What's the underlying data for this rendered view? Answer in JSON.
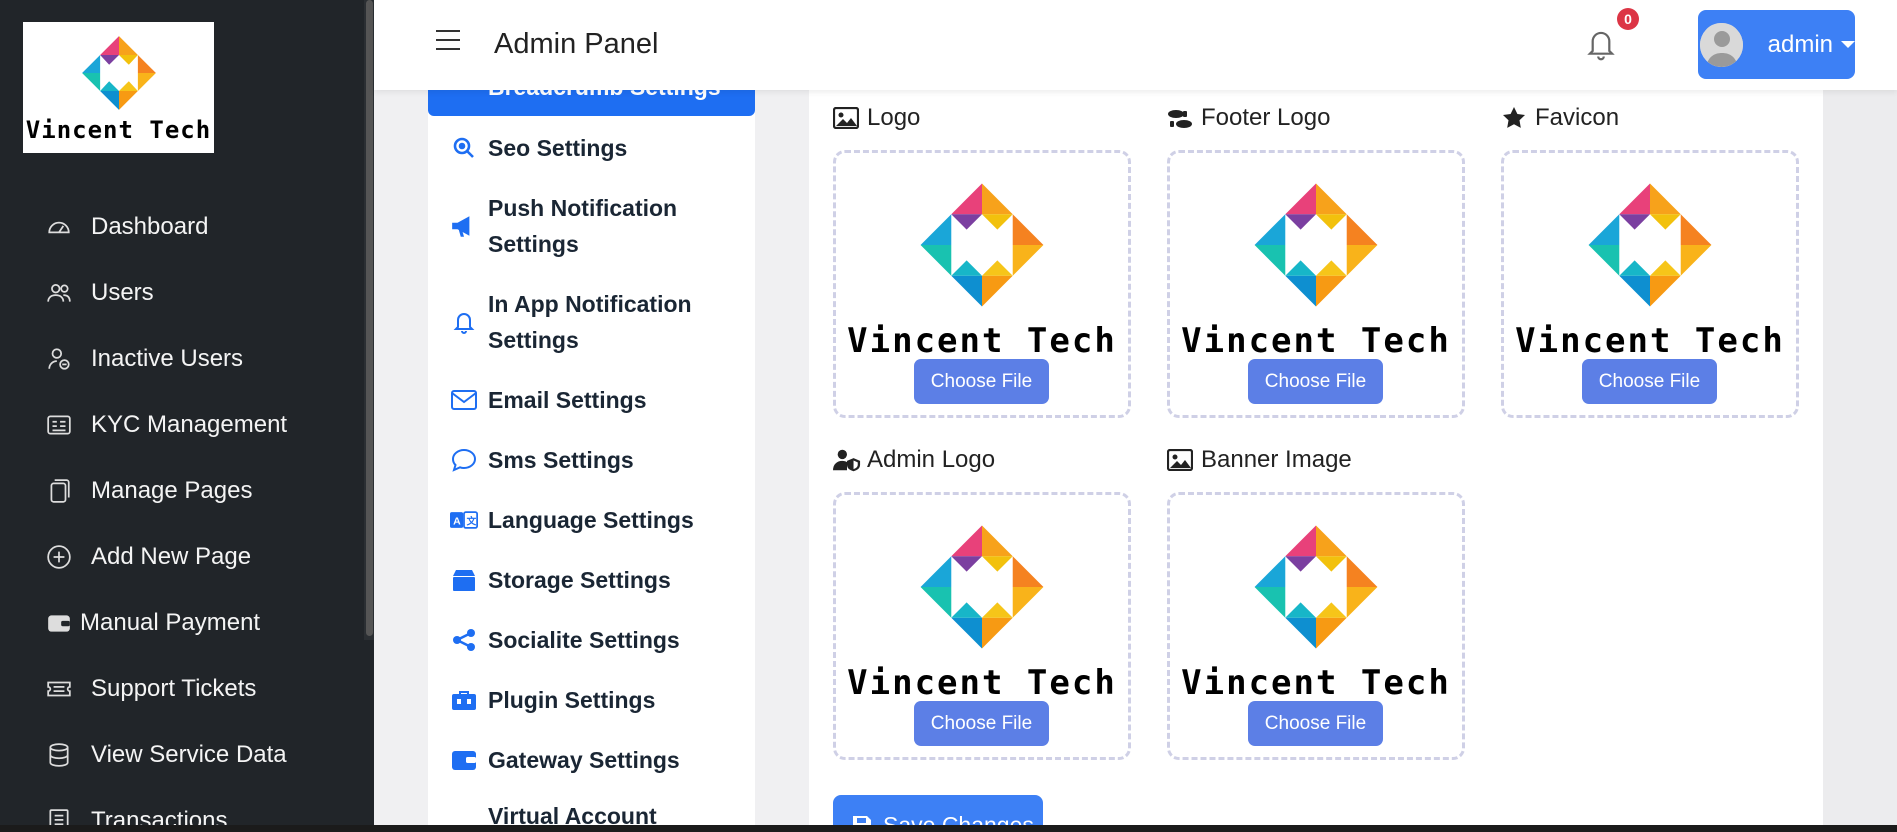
{
  "brand": {
    "name": "Vincent Tech"
  },
  "sidebar": {
    "items": [
      {
        "label": "Dashboard",
        "icon": "dashboard-gauge-icon"
      },
      {
        "label": "Users",
        "icon": "users-icon"
      },
      {
        "label": "Inactive Users",
        "icon": "inactive-user-icon"
      },
      {
        "label": "KYC Management",
        "icon": "id-card-icon"
      },
      {
        "label": "Manage Pages",
        "icon": "pages-icon"
      },
      {
        "label": "Add New Page",
        "icon": "plus-circle-icon"
      },
      {
        "label": "Manual Payment",
        "icon": "wallet-icon"
      },
      {
        "label": "Support Tickets",
        "icon": "ticket-icon"
      },
      {
        "label": "View Service Data",
        "icon": "database-icon"
      },
      {
        "label": "Transactions",
        "icon": "receipt-icon"
      }
    ]
  },
  "topbar": {
    "title": "Admin Panel",
    "notification_count": "0",
    "user_name": "admin"
  },
  "settings_menu": {
    "active_item": "Breadcrumb Settings",
    "items": [
      {
        "label": "Seo Settings",
        "icon": "search-icon"
      },
      {
        "label": "Push Notification Settings",
        "icon": "megaphone-icon"
      },
      {
        "label": "In App Notification Settings",
        "icon": "bell-icon"
      },
      {
        "label": "Email Settings",
        "icon": "envelope-icon"
      },
      {
        "label": "Sms Settings",
        "icon": "chat-icon"
      },
      {
        "label": "Language Settings",
        "icon": "translate-icon"
      },
      {
        "label": "Storage Settings",
        "icon": "box-icon"
      },
      {
        "label": "Socialite Settings",
        "icon": "share-icon"
      },
      {
        "label": "Plugin Settings",
        "icon": "toolbox-icon"
      },
      {
        "label": "Gateway Settings",
        "icon": "wallet-icon"
      },
      {
        "label": "Virtual Account",
        "icon": ""
      }
    ]
  },
  "uploads": [
    {
      "label": "Logo",
      "icon": "image-icon",
      "button": "Choose File"
    },
    {
      "label": "Footer Logo",
      "icon": "shoe-prints-icon",
      "button": "Choose File"
    },
    {
      "label": "Favicon",
      "icon": "star-icon",
      "button": "Choose File"
    },
    {
      "label": "Admin Logo",
      "icon": "user-shield-icon",
      "button": "Choose File"
    },
    {
      "label": "Banner Image",
      "icon": "image-icon",
      "button": "Choose File"
    }
  ],
  "actions": {
    "save_label": "Save Changes"
  },
  "colors": {
    "sidebar_bg": "#212529",
    "accent": "#1e6ef2",
    "choose_button": "#5c7fe6",
    "badge": "#dc3545"
  }
}
